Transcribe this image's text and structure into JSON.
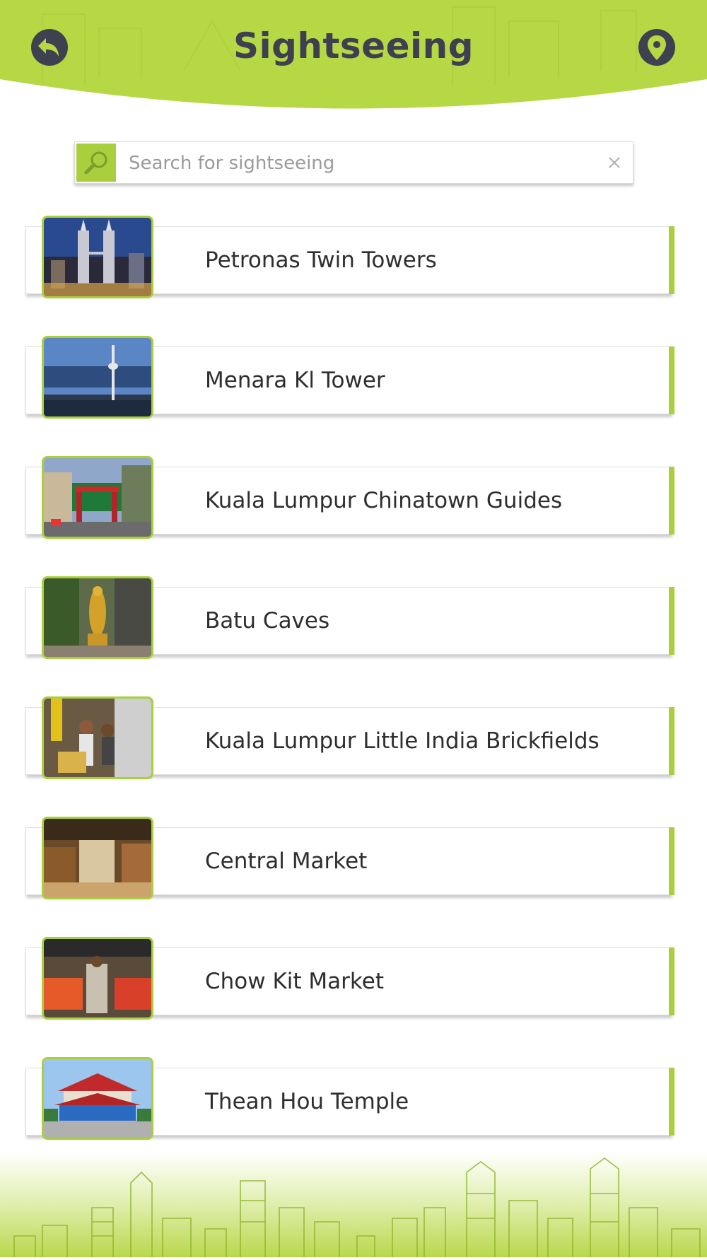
{
  "header": {
    "title": "Sightseeing",
    "back_icon": "back-arrow-icon",
    "location_icon": "map-pin-icon"
  },
  "search": {
    "placeholder": "Search for sightseeing",
    "value": "",
    "icon": "magnifier-icon",
    "clear_icon": "close-icon"
  },
  "items": [
    {
      "label": "Petronas Twin Towers"
    },
    {
      "label": "Menara Kl Tower"
    },
    {
      "label": "Kuala Lumpur Chinatown Guides"
    },
    {
      "label": "Batu Caves"
    },
    {
      "label": "Kuala Lumpur Little India Brickfields"
    },
    {
      "label": "Central Market"
    },
    {
      "label": "Chow Kit Market"
    },
    {
      "label": "Thean Hou Temple"
    }
  ],
  "colors": {
    "accent": "#a9cf3c",
    "header_bg": "#b5d844",
    "title_text": "#3f3f52",
    "icon_dark": "#3d4150"
  }
}
